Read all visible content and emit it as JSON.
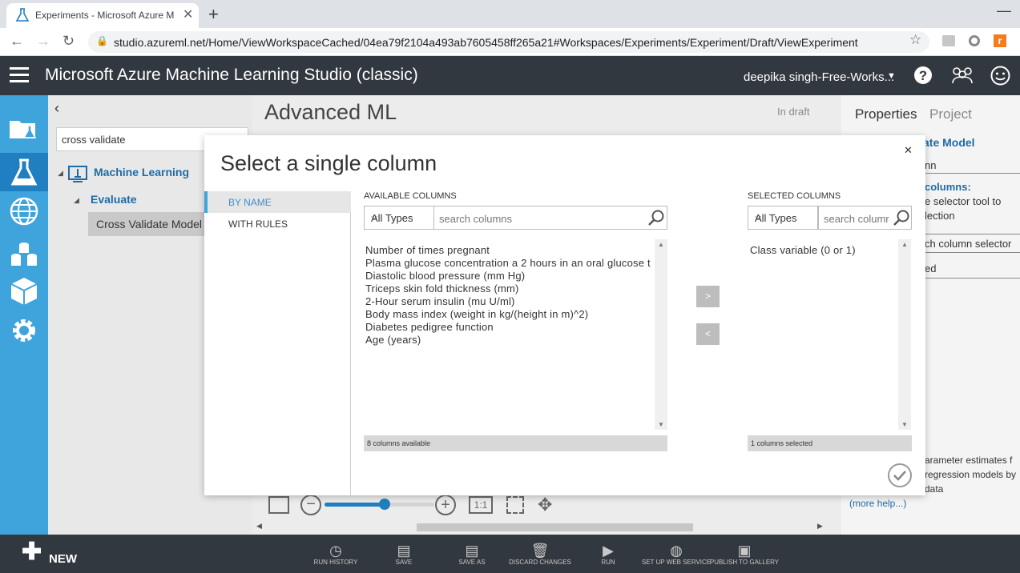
{
  "browser": {
    "tab_title": "Experiments - Microsoft Azure M",
    "url": "studio.azureml.net/Home/ViewWorkspaceCached/04ea79f2104a493ab7605458ff265a21#Workspaces/Experiments/Experiment/Draft/ViewExperiment"
  },
  "app": {
    "title": "Microsoft Azure Machine Learning Studio (classic)",
    "user": "deepika singh-Free-Works..."
  },
  "palette": {
    "search_value": "cross validate",
    "tree": {
      "root": "Machine Learning",
      "child": "Evaluate",
      "leaf": "Cross Validate Model"
    }
  },
  "canvas": {
    "experiment_title": "Advanced ML",
    "status": "In draft"
  },
  "properties": {
    "tabs": [
      "Properties",
      "Project"
    ],
    "fragments": {
      "module": "ate Model",
      "column": "nn",
      "label_columns": "columns:",
      "hint1": "e selector tool to",
      "hint2": "lection",
      "launch": "ch column selector",
      "selected": "ed",
      "desc1": "arameter estimates f",
      "desc2": "regression models by",
      "desc3": "data",
      "more_help": "(more help...)"
    }
  },
  "bottombar": {
    "new_label": "NEW",
    "items": [
      "RUN HISTORY",
      "SAVE",
      "SAVE AS",
      "DISCARD CHANGES",
      "RUN",
      "SET UP WEB SERVICE",
      "PUBLISH TO GALLERY"
    ]
  },
  "dialog": {
    "title": "Select a single column",
    "nav": [
      "BY NAME",
      "WITH RULES"
    ],
    "available": {
      "label": "AVAILABLE COLUMNS",
      "type_filter": "All Types",
      "search_placeholder": "search columns",
      "columns": [
        "Number of times pregnant",
        "Plasma glucose concentration a 2 hours in an oral glucose t",
        "Diastolic blood pressure (mm Hg)",
        "Triceps skin fold thickness (mm)",
        "2-Hour serum insulin (mu U/ml)",
        "Body mass index (weight in kg/(height in m)^2)",
        "Diabetes pedigree function",
        "Age (years)"
      ],
      "status": "8 columns available"
    },
    "selected": {
      "label": "SELECTED COLUMNS",
      "type_filter": "All Types",
      "search_placeholder": "search columr",
      "columns": [
        "Class variable (0 or 1)"
      ],
      "status": "1 columns selected"
    },
    "add_label": ">",
    "remove_label": "<"
  },
  "zoom": {
    "fit_label": "1:1",
    "level": 0.55
  }
}
